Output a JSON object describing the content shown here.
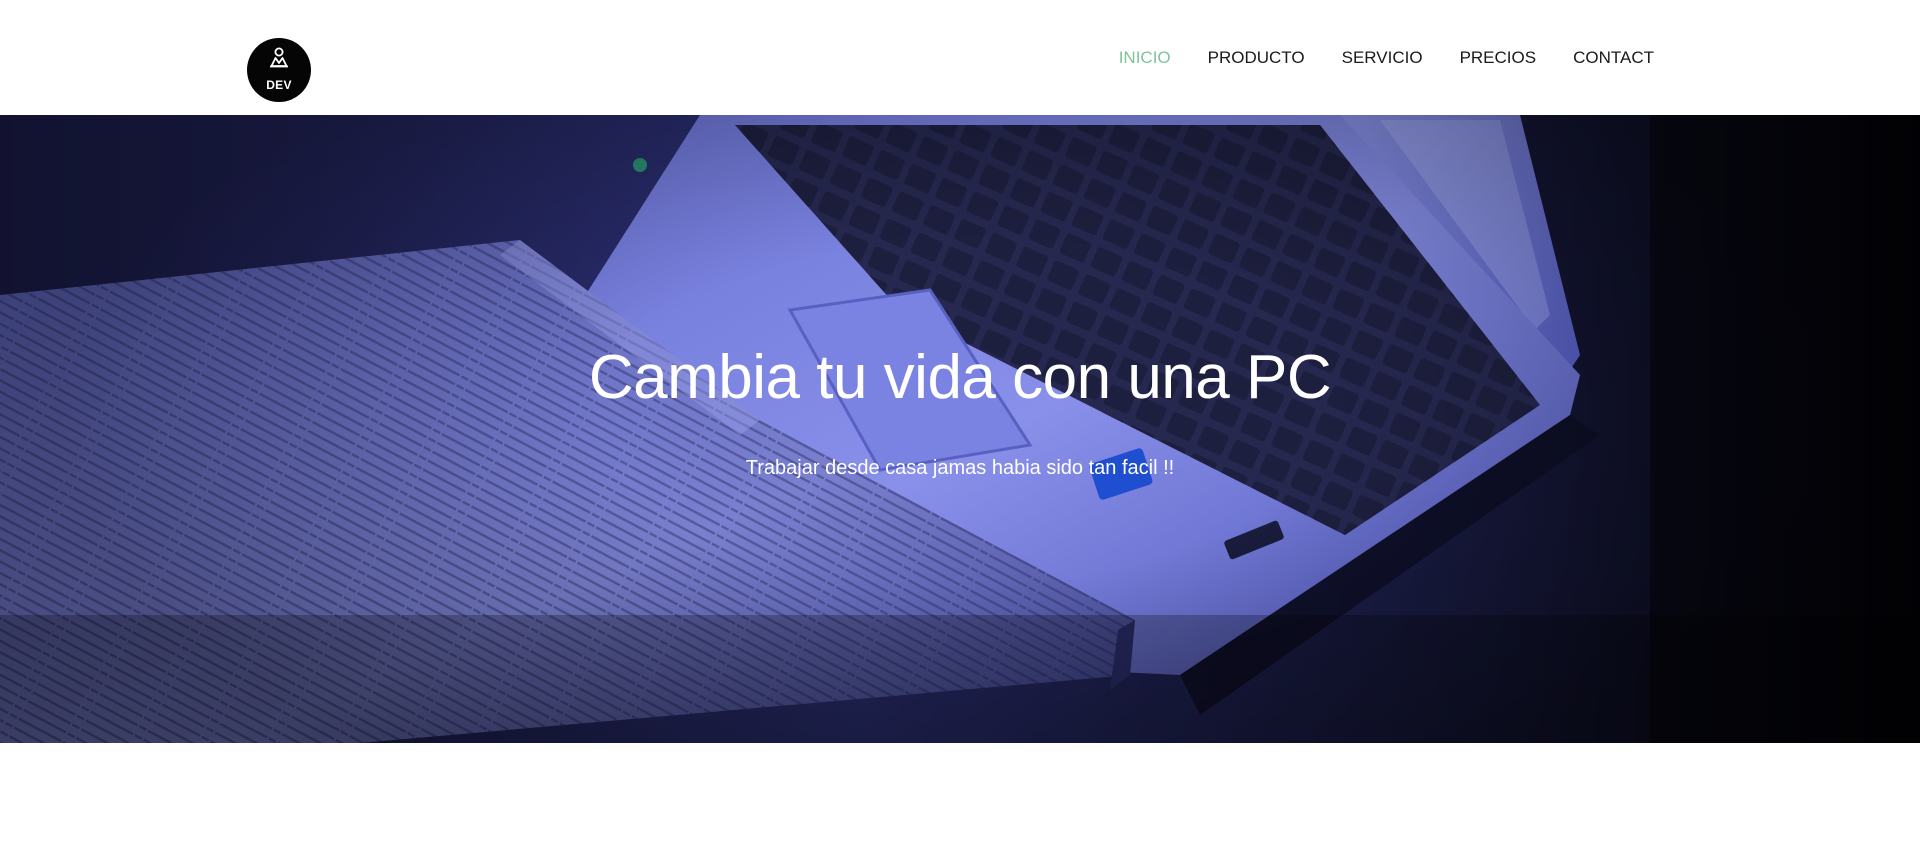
{
  "brand": {
    "logo_text": "DEV"
  },
  "nav": {
    "items": [
      {
        "label": "INICIO",
        "active": true
      },
      {
        "label": "PRODUCTO",
        "active": false
      },
      {
        "label": "SERVICIO",
        "active": false
      },
      {
        "label": "PRECIOS",
        "active": false
      },
      {
        "label": "CONTACT",
        "active": false
      }
    ]
  },
  "hero": {
    "title": "Cambia tu vida con una PC",
    "subtitle": "Trabajar desde casa jamas habia sido tan facil !!"
  },
  "colors": {
    "accent": "#7fc39a",
    "logo_bg": "#050505",
    "hero_tint": "#3d44a8"
  }
}
